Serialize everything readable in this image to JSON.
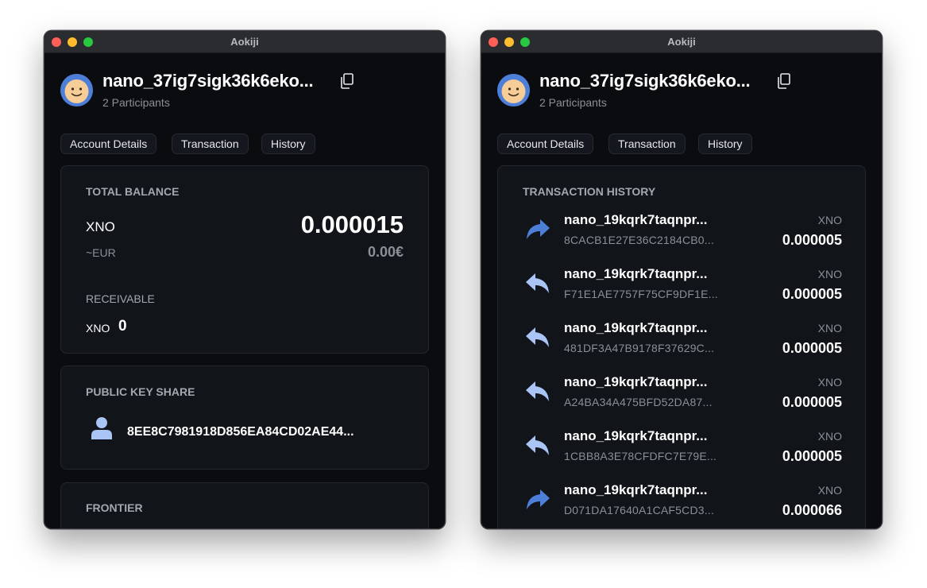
{
  "colors": {
    "background": "#0a0c10",
    "card": "#111419",
    "muted": "#8b8f96",
    "accent_send": "#4d7fd9",
    "accent_receive": "#a9c4f5"
  },
  "windows": [
    {
      "title": "Aokiji",
      "account": {
        "name": "nano_37ig7sigk36k6eko...",
        "participants": "2 Participants"
      },
      "tabs": [
        "Account Details",
        "Transaction",
        "History"
      ],
      "balance": {
        "title": "TOTAL BALANCE",
        "currency": "XNO",
        "amount": "0.000015",
        "fiat_label": "~EUR",
        "fiat_value": "0.00€",
        "receivable_title": "RECEIVABLE",
        "receivable_currency": "XNO",
        "receivable_value": "0"
      },
      "public_key": {
        "title": "PUBLIC KEY SHARE",
        "icon": "person-icon",
        "value": "8EE8C7981918D856EA84CD02AE44..."
      },
      "frontier": {
        "title": "FRONTIER"
      }
    },
    {
      "title": "Aokiji",
      "account": {
        "name": "nano_37ig7sigk36k6eko...",
        "participants": "2 Participants"
      },
      "tabs": [
        "Account Details",
        "Transaction",
        "History"
      ],
      "history": {
        "title": "TRANSACTION HISTORY",
        "transactions": [
          {
            "direction": "send",
            "icon": "send-arrow-icon",
            "address": "nano_19kqrk7taqnpr...",
            "hash": "8CACB1E27E36C2184CB0...",
            "currency": "XNO",
            "amount": "0.000005"
          },
          {
            "direction": "receive",
            "icon": "receive-arrow-icon",
            "address": "nano_19kqrk7taqnpr...",
            "hash": "F71E1AE7757F75CF9DF1E...",
            "currency": "XNO",
            "amount": "0.000005"
          },
          {
            "direction": "receive",
            "icon": "receive-arrow-icon",
            "address": "nano_19kqrk7taqnpr...",
            "hash": "481DF3A47B9178F37629C...",
            "currency": "XNO",
            "amount": "0.000005"
          },
          {
            "direction": "receive",
            "icon": "receive-arrow-icon",
            "address": "nano_19kqrk7taqnpr...",
            "hash": "A24BA34A475BFD52DA87...",
            "currency": "XNO",
            "amount": "0.000005"
          },
          {
            "direction": "receive",
            "icon": "receive-arrow-icon",
            "address": "nano_19kqrk7taqnpr...",
            "hash": "1CBB8A3E78CFDFC7E79E...",
            "currency": "XNO",
            "amount": "0.000005"
          },
          {
            "direction": "send",
            "icon": "send-arrow-icon",
            "address": "nano_19kqrk7taqnpr...",
            "hash": "D071DA17640A1CAF5CD3...",
            "currency": "XNO",
            "amount": "0.000066"
          }
        ]
      }
    }
  ]
}
